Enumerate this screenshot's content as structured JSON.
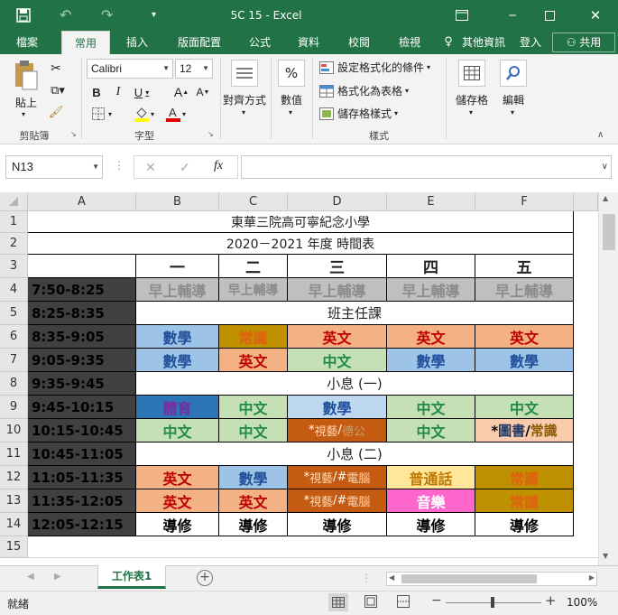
{
  "title": "5C 15 - Excel",
  "tabs": [
    "檔案",
    "常用",
    "插入",
    "版面配置",
    "公式",
    "資料",
    "校閱",
    "檢視"
  ],
  "tell_me": "其他資訊",
  "sign_in": "登入",
  "share": "共用",
  "ribbon": {
    "paste": "貼上",
    "clipboard": "剪貼簿",
    "font_name": "Calibri",
    "font_size": "12",
    "font": "字型",
    "alignment": "對齊方式",
    "number": "數值",
    "conditional_formatting": "設定格式化的條件",
    "format_as_table": "格式化為表格",
    "cell_styles": "儲存格樣式",
    "styles": "樣式",
    "cells": "儲存格",
    "editing": "編輯"
  },
  "formula_bar": {
    "name_box": "N13",
    "fx": "fx",
    "formula": ""
  },
  "columns": [
    "A",
    "B",
    "C",
    "D",
    "E",
    "F"
  ],
  "rows": [
    "1",
    "2",
    "3",
    "4",
    "5",
    "6",
    "7",
    "8",
    "9",
    "10",
    "11",
    "12",
    "13",
    "14",
    "15"
  ],
  "sheet": {
    "r1": "東華三院高可寧紀念小學",
    "r2": "2020－2021 年度  時間表",
    "days": [
      "一",
      "二",
      "三",
      "四",
      "五"
    ],
    "times": [
      "7:50-8:25",
      "8:25-8:35",
      "8:35-9:05",
      "9:05-9:35",
      "9:35-9:45",
      "9:45-10:15",
      "10:15-10:45",
      "10:45-11:05",
      "11:05-11:35",
      "11:35-12:05",
      "12:05-12:15"
    ],
    "r4": [
      "早上輔導",
      "早上輔導",
      "早上輔導",
      "早上輔導",
      "早上輔導"
    ],
    "r5": "班主任課",
    "r6": [
      "數學",
      "常識",
      "英文",
      "英文",
      "英文"
    ],
    "r7": [
      "數學",
      "英文",
      "中文",
      "數學",
      "數學"
    ],
    "r8": "小息 (一)",
    "r9": [
      "體育",
      "中文",
      "數學",
      "中文",
      "中文"
    ],
    "r10": [
      [
        "*",
        "視藝",
        "/",
        "德公"
      ],
      "中文",
      "中文",
      [
        "*",
        "圖書",
        "/",
        "常識"
      ],
      "中文"
    ],
    "r11": "小息 (二)",
    "r12": [
      "英文",
      "數學",
      [
        "*",
        "視藝",
        "/#",
        "電腦"
      ],
      "普通話",
      "常識"
    ],
    "r13": [
      "英文",
      "英文",
      [
        "*",
        "視藝",
        "/#",
        "電腦"
      ],
      "音樂",
      "常識"
    ],
    "r14": [
      "導修",
      "導修",
      "導修",
      "導修",
      "導修"
    ]
  },
  "sheet_tab": "工作表1",
  "status": {
    "ready": "就緒",
    "zoom": "100%"
  },
  "colors": {
    "excel_green": "#217346",
    "math": "#9dc3e6",
    "chinese": "#c5e0b4",
    "english": "#f4b183",
    "gs": "#bf9000",
    "pe": "#2e75b6",
    "va": "#c55a11",
    "pth": "#ffe699",
    "music": "#ff66cc",
    "time_bg": "#404040",
    "am_bg": "#bfbfbf"
  }
}
